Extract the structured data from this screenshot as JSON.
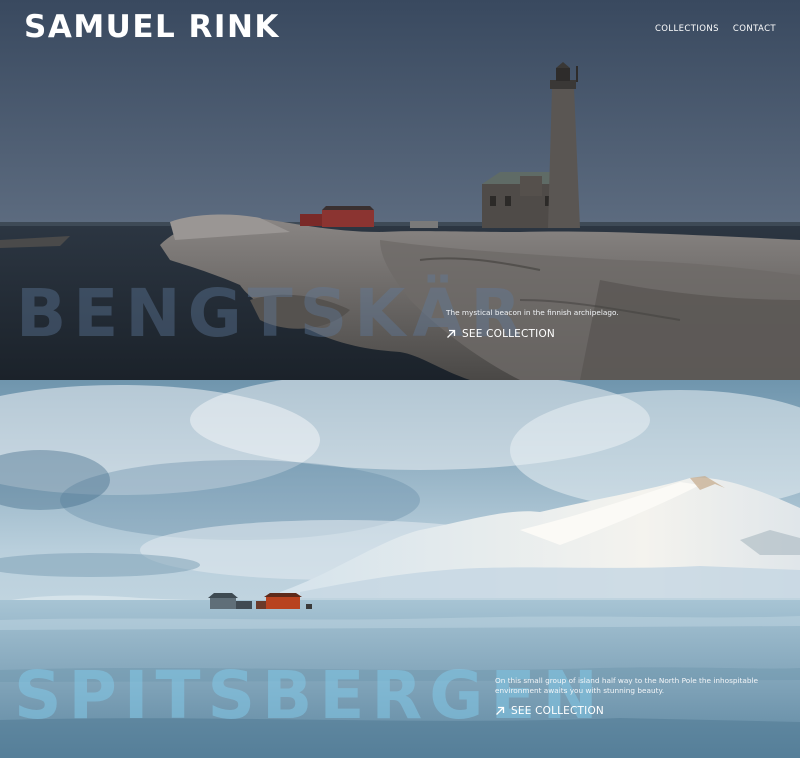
{
  "header": {
    "title": "SAMUEL RINK",
    "nav": [
      {
        "label": "COLLECTIONS"
      },
      {
        "label": "CONTACT"
      }
    ]
  },
  "collections": [
    {
      "name": "BENGTSKÄR",
      "description": "The mystical beacon in the finnish archipelago.",
      "cta": "SEE COLLECTION",
      "cta_icon": "arrow-up-right-icon"
    },
    {
      "name": "SPITSBERGEN",
      "description": "On this small group of island half way to the North Pole the inhospitable environment awaits you with stunning beauty.",
      "cta": "SEE COLLECTION",
      "cta_icon": "arrow-up-right-icon"
    }
  ],
  "colors": {
    "text": "#ffffff",
    "panel1_sky": "#3a4a62",
    "panel2_sky": "#8fb5cc"
  }
}
